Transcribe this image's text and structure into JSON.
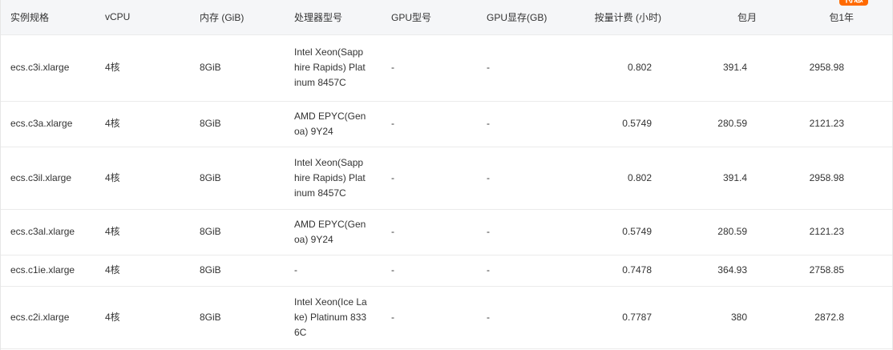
{
  "header": {
    "instance_type": "实例规格",
    "vcpu": "vCPU",
    "memory": "内存 (GiB)",
    "cpu_model": "处理器型号",
    "gpu_model": "GPU型号",
    "gpu_memory": "GPU显存(GB)",
    "hourly": "按量计费 (小时)",
    "monthly": "包月",
    "yearly": "包1年",
    "promo_badge": "特惠"
  },
  "rows": [
    {
      "instance": "ecs.c3i.xlarge",
      "vcpu": "4核",
      "memory": "8GiB",
      "cpu": "Intel Xeon(Sapphire Rapids) Platinum 8457C",
      "gpu": "-",
      "gpu_mem": "-",
      "hourly": "0.802",
      "monthly": "391.4",
      "yearly": "2958.98"
    },
    {
      "instance": "ecs.c3a.xlarge",
      "vcpu": "4核",
      "memory": "8GiB",
      "cpu": "AMD EPYC(Genoa) 9Y24",
      "gpu": "-",
      "gpu_mem": "-",
      "hourly": "0.5749",
      "monthly": "280.59",
      "yearly": "2121.23"
    },
    {
      "instance": "ecs.c3il.xlarge",
      "vcpu": "4核",
      "memory": "8GiB",
      "cpu": "Intel Xeon(Sapphire Rapids) Platinum 8457C",
      "gpu": "-",
      "gpu_mem": "-",
      "hourly": "0.802",
      "monthly": "391.4",
      "yearly": "2958.98"
    },
    {
      "instance": "ecs.c3al.xlarge",
      "vcpu": "4核",
      "memory": "8GiB",
      "cpu": "AMD EPYC(Genoa) 9Y24",
      "gpu": "-",
      "gpu_mem": "-",
      "hourly": "0.5749",
      "monthly": "280.59",
      "yearly": "2121.23"
    },
    {
      "instance": "ecs.c1ie.xlarge",
      "vcpu": "4核",
      "memory": "8GiB",
      "cpu": "-",
      "gpu": "-",
      "gpu_mem": "-",
      "hourly": "0.7478",
      "monthly": "364.93",
      "yearly": "2758.85"
    },
    {
      "instance": "ecs.c2i.xlarge",
      "vcpu": "4核",
      "memory": "8GiB",
      "cpu": "Intel Xeon(Ice Lake) Platinum 8336C",
      "gpu": "-",
      "gpu_mem": "-",
      "hourly": "0.7787",
      "monthly": "380",
      "yearly": "2872.8"
    }
  ],
  "colors": {
    "header_bg": "#f5f6f8",
    "badge_bg": "#ff6a00",
    "border": "#ebebeb"
  }
}
